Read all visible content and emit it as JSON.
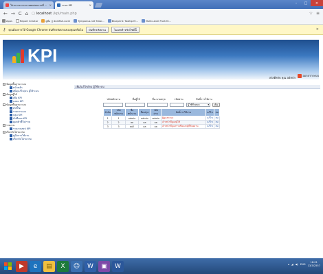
{
  "browser": {
    "tabs": [
      {
        "title": "โปรแกรม กระดาษทดสอบงานที่ ...",
        "close": "×"
      },
      {
        "title": "ระบบ KPI",
        "close": "×"
      }
    ],
    "window_controls": {
      "minimize": "–",
      "maximize": "□",
      "close": "×"
    },
    "nav": {
      "back": "←",
      "forward": "→",
      "reload": "C",
      "home": "⌂"
    },
    "url_host": "localhost",
    "url_path": "/kpi/main.php",
    "star": "☆",
    "menu": "≡",
    "bookmarks": [
      "Apps",
      "Report Creator",
      "คู่มือ || dealfish.co.th",
      "Tympanus.net Tutor...",
      "Blueprint: Tooltip M...",
      "Multi-Level Push M..."
    ],
    "infobar": {
      "message": "คุณต้องการให้ Google Chrome บันทึกรหัสผ่านของคุณหรือไม่",
      "save": "บันทึกรหัสผ่าน",
      "never": "ไม่เลยสำหรับไซต์นี้",
      "close": "×"
    }
  },
  "header": {
    "logo_text": "KPI",
    "user_line": "สวัสดีครับ คุณ admin",
    "logout": "ออกจากระบบ"
  },
  "sidebar": {
    "sections": [
      {
        "label": "ข้อมูลพื้นฐานระบบ",
        "items": [
          "หน้าหลัก",
          "เพิ่ม/แก้ไข/ลบ ผู้ใช้ระบบ"
        ]
      },
      {
        "label": "ข้อมูลผู้ใช้",
        "items": [
          "เพิ่ม KPI",
          "แสดง KPI"
        ]
      },
      {
        "label": "ข้อมูลพื้นฐานระบบ",
        "items": [
          "ตัวชี้วัด",
          "รายการแบบ",
          "กลุ่ม KPI",
          "บันทึกผล KPI",
          "ดูผลตัวชี้วัด/ราย"
        ]
      },
      {
        "label": "รายงาน",
        "items": [
          "รายงานสรุป KPI"
        ]
      },
      {
        "label": "เกี่ยวกับโปรแกรม",
        "items": [
          "คู่มือการใช้งาน",
          "เกี่ยวกับโปรแกรม"
        ]
      }
    ]
  },
  "content": {
    "breadcrumb": "เพิ่ม/แก้ไข/ลบ ผู้ใช้ระบบ",
    "filter_labels": [
      "รหัสพนักงาน",
      "ชื่อผู้ใช้",
      "ชื่อ-นามสกุล",
      "รหัสผ่าน",
      "สิทธิ์การใช้งาน"
    ],
    "filter_select_value": "ผู้ใช้ทั้งหมด",
    "search_button": "ค้น",
    "table_headers": [
      "ลำดับ",
      "รหัสพนักงาน",
      "ชื่อพนักงาน",
      "ชื่อ-สกุล",
      "รหัสผ่าน",
      "สิทธิ์การใช้งาน",
      "แก้ไข",
      "ลบ"
    ],
    "rows": [
      [
        "1",
        "1",
        "admin",
        "admin",
        "admin",
        "ผู้ดูแลระบบ",
        "แก้ไข",
        "ลบ"
      ],
      [
        "2",
        "2",
        "aa",
        "aa",
        "aa",
        "เจ้าหน้าที่ดูแลผู้ใช้",
        "แก้ไข",
        "ลบ"
      ],
      [
        "3",
        "3",
        "aa2",
        "aa",
        "aa",
        "เจ้าหน้าที่ดูแลรายชื่อและผู้ที่ต้องอ่าน",
        "แก้ไข",
        "ลบ"
      ]
    ]
  },
  "taskbar": {
    "apps": [
      "windows-start",
      "media",
      "internet-explorer",
      "file-explorer",
      "excel",
      "people",
      "word-or-doc",
      "photo",
      "word"
    ],
    "lang": "ENG",
    "time": "18:01",
    "date": "13/3/2557"
  },
  "colors": {
    "brand_blue": "#2f6bb5",
    "accent_red": "#d43a2b",
    "taskbar": "#2c5589"
  }
}
